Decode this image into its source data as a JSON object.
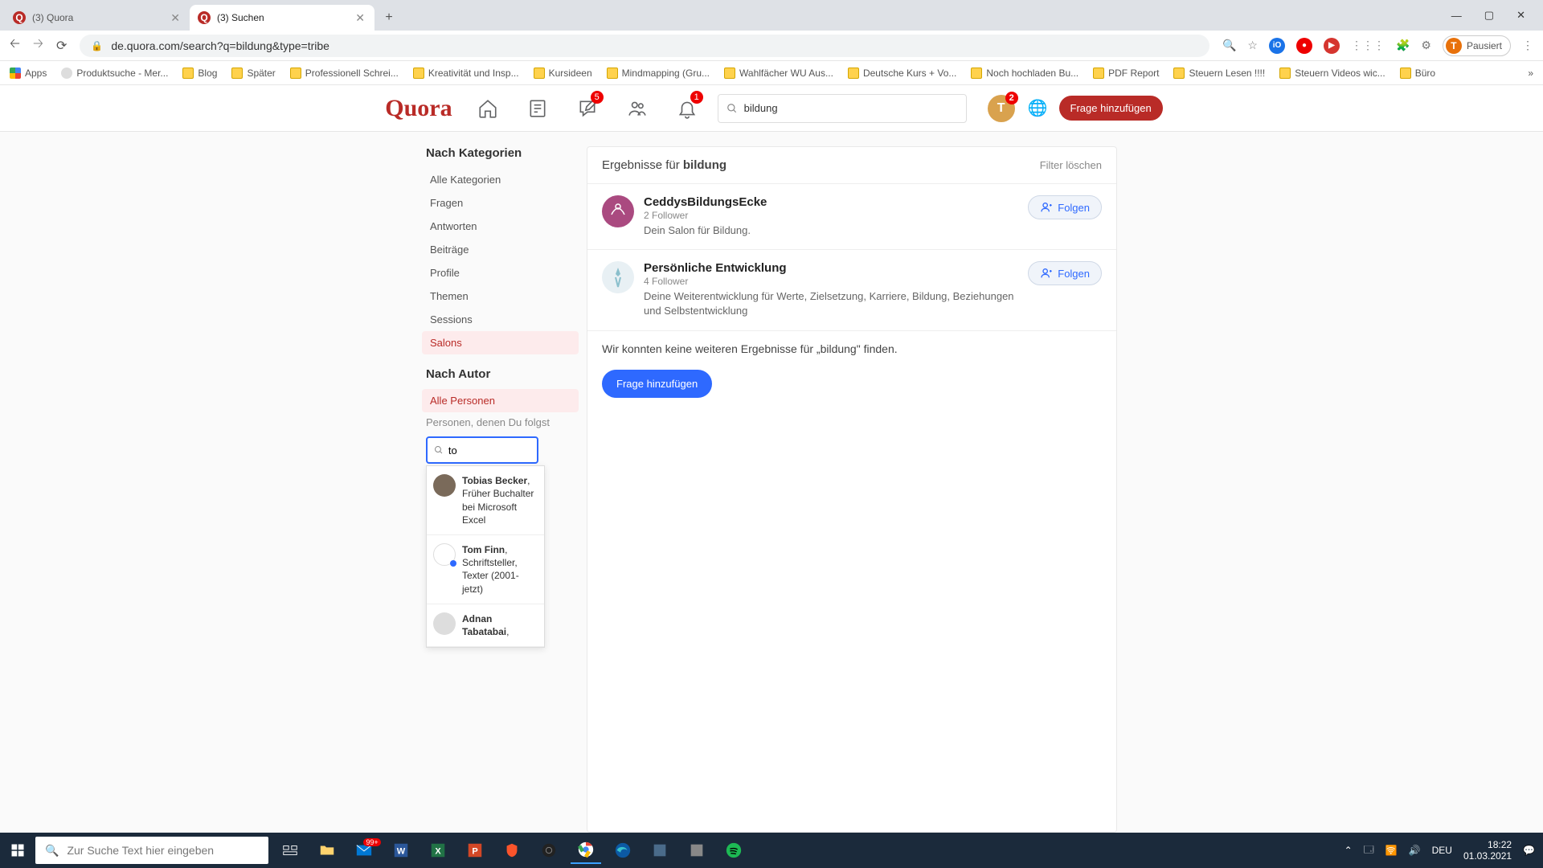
{
  "browser": {
    "tabs": [
      {
        "title": "(3) Quora"
      },
      {
        "title": "(3) Suchen"
      }
    ],
    "url": "de.quora.com/search?q=bildung&type=tribe",
    "pauseLabel": "Pausiert",
    "profileInitial": "T",
    "bookmarks": [
      "Apps",
      "Produktsuche - Mer...",
      "Blog",
      "Später",
      "Professionell Schrei...",
      "Kreativität und Insp...",
      "Kursideen",
      "Mindmapping (Gru...",
      "Wahlfächer WU Aus...",
      "Deutsche Kurs + Vo...",
      "Noch hochladen Bu...",
      "PDF Report",
      "Steuern Lesen !!!!",
      "Steuern Videos wic...",
      "Büro"
    ]
  },
  "quora": {
    "logo": "Quora",
    "navBadges": {
      "following": "5",
      "notifications": "1",
      "avatar": "2"
    },
    "searchValue": "bildung",
    "addQuestion": "Frage hinzufügen",
    "avatarInitial": "T"
  },
  "sidebar": {
    "catHead": "Nach Kategorien",
    "categories": [
      "Alle Kategorien",
      "Fragen",
      "Antworten",
      "Beiträge",
      "Profile",
      "Themen",
      "Sessions",
      "Salons"
    ],
    "activeIdx": 7,
    "authorHead": "Nach Autor",
    "allPersons": "Alle Personen",
    "following": "Personen, denen Du folgst",
    "searchValue": "to",
    "dropdown": [
      {
        "name": "Tobias Becker",
        "desc": "Früher Buchalter bei Microsoft Excel"
      },
      {
        "name": "Tom Finn",
        "desc": "Schriftsteller, Texter (2001-jetzt)"
      },
      {
        "name": "Adnan Tabatabai",
        "desc": ""
      }
    ]
  },
  "results": {
    "headPrefix": "Ergebnisse für ",
    "headTerm": "bildung",
    "clearFilter": "Filter löschen",
    "followLabel": "Folgen",
    "items": [
      {
        "name": "CeddysBildungsEcke",
        "followers": "2 Follower",
        "desc": "Dein Salon für Bildung."
      },
      {
        "name": "Persönliche Entwicklung",
        "followers": "4 Follower",
        "desc": "Deine Weiterentwicklung für Werte, Zielsetzung, Karriere, Bildung, Beziehungen und Selbstentwicklung"
      }
    ],
    "noMore": "Wir konnten keine weiteren Ergebnisse für „bildung\" finden.",
    "addQuestion": "Frage hinzufügen"
  },
  "taskbar": {
    "searchPlaceholder": "Zur Suche Text hier eingeben",
    "mailCount": "99+",
    "lang": "DEU",
    "time": "18:22",
    "date": "01.03.2021"
  }
}
